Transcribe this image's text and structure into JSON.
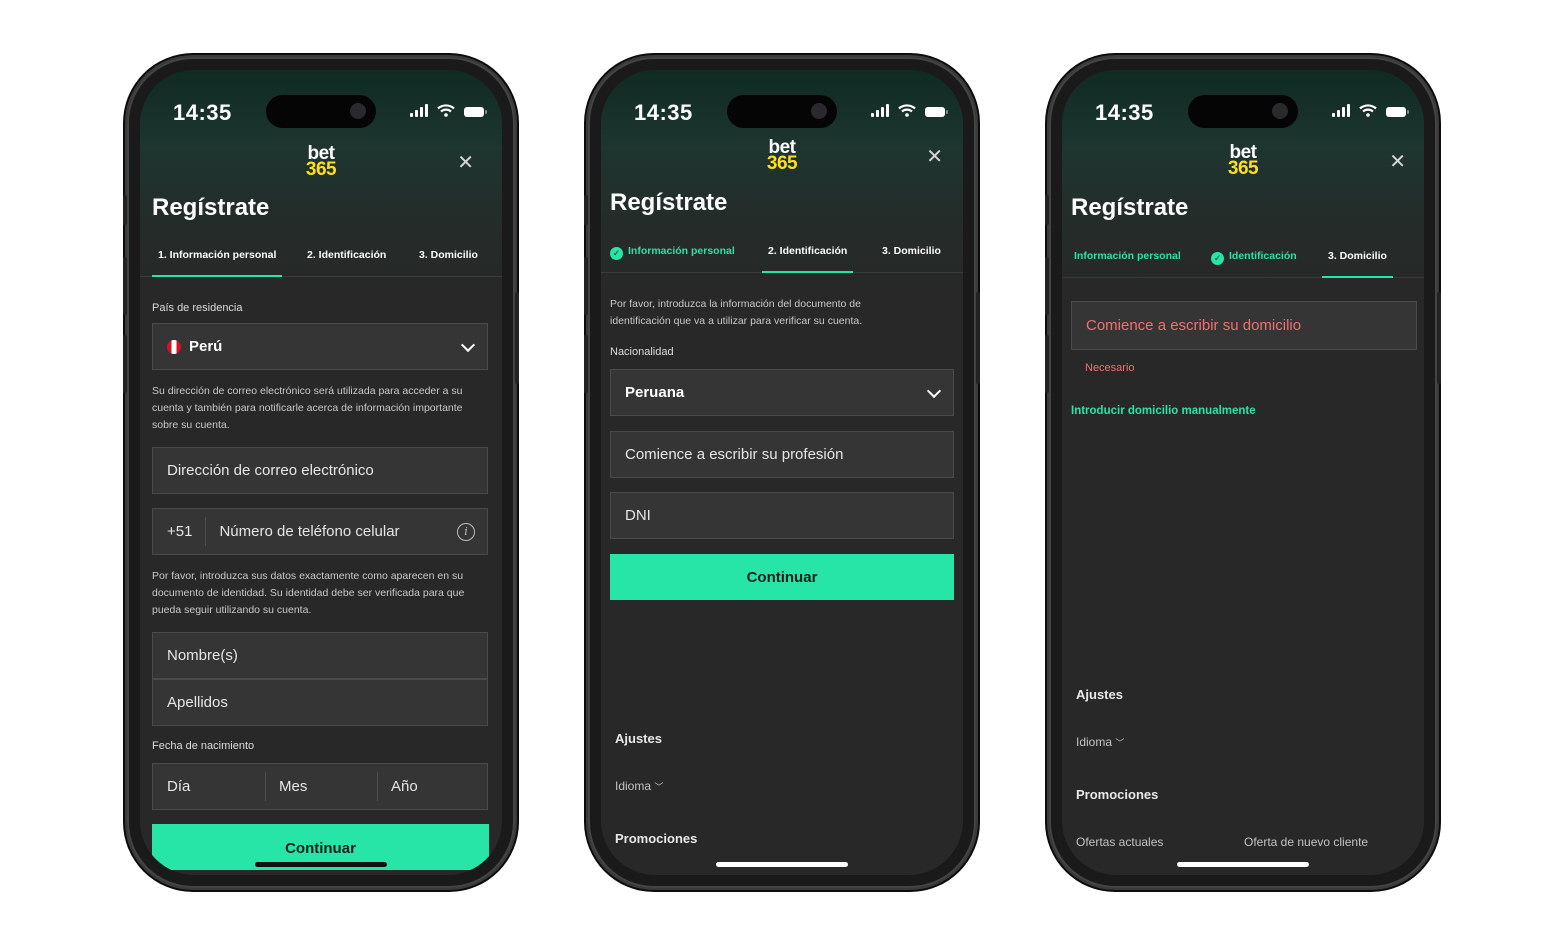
{
  "status_time": "14:35",
  "logo": {
    "top": "bet",
    "bottom": "365"
  },
  "title": "Regístrate",
  "colors": {
    "accent": "#26e5a7",
    "brand_yellow": "#ffdf1b",
    "error": "#f26f6f",
    "bg": "#282828"
  },
  "screen1": {
    "tabs": [
      "1. Información personal",
      "2. Identificación",
      "3. Domicilio"
    ],
    "residence_label": "País de residencia",
    "country": "Perú",
    "email_note": "Su dirección de correo electrónico será utilizada para acceder a su cuenta y también para notificarle acerca de información importante sobre su cuenta.",
    "email_placeholder": "Dirección de correo electrónico",
    "phone_prefix": "+51",
    "phone_placeholder": "Número de teléfono celular",
    "identity_note": "Por favor, introduzca sus datos exactamente como aparecen en su documento de identidad. Su identidad debe ser verificada para que pueda seguir utilizando su cuenta.",
    "first_name_placeholder": "Nombre(s)",
    "last_name_placeholder": "Apellidos",
    "dob_label": "Fecha de nacimiento",
    "dob": {
      "day": "Día",
      "month": "Mes",
      "year": "Año"
    },
    "continue": "Continuar"
  },
  "screen2": {
    "tabs": [
      "Información personal",
      "2. Identificación",
      "3. Domicilio"
    ],
    "doc_note": "Por favor, introduzca la información del documento de identificación que va a utilizar para verificar su cuenta.",
    "nationality_label": "Nacionalidad",
    "nationality": "Peruana",
    "profession_placeholder": "Comience a escribir su profesión",
    "dni_placeholder": "DNI",
    "continue": "Continuar",
    "settings": "Ajustes",
    "language": "Idioma",
    "promotions": "Promociones"
  },
  "screen3": {
    "tabs": [
      "Información personal",
      "Identificación",
      "3. Domicilio"
    ],
    "address_placeholder": "Comience a escribir su domicilio",
    "required": "Necesario",
    "manual_link": "Introducir domicilio manualmente",
    "settings": "Ajustes",
    "language": "Idioma",
    "promotions": "Promociones",
    "current_offers": "Ofertas actuales",
    "new_customer_offer": "Oferta de nuevo cliente"
  }
}
